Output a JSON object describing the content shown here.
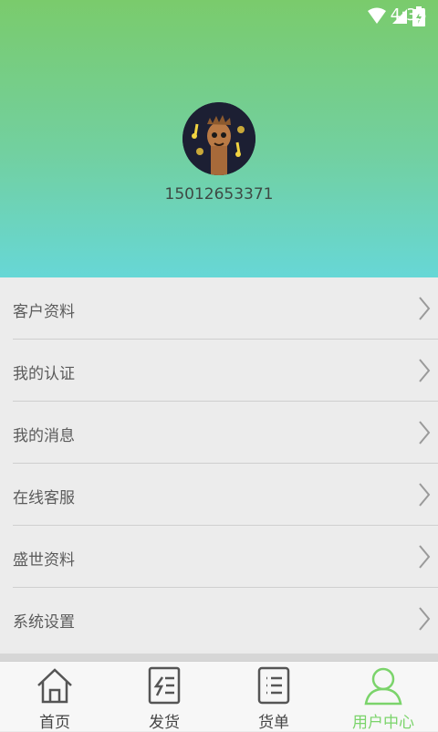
{
  "status_bar": {
    "time": "4:35"
  },
  "profile": {
    "phone": "15012653371"
  },
  "menu": [
    {
      "label": "客户资料"
    },
    {
      "label": "我的认证"
    },
    {
      "label": "我的消息"
    },
    {
      "label": "在线客服"
    },
    {
      "label": "盛世资料"
    },
    {
      "label": "系统设置"
    }
  ],
  "tabs": [
    {
      "label": "首页",
      "icon": "home-icon"
    },
    {
      "label": "发货",
      "icon": "shipping-icon"
    },
    {
      "label": "货单",
      "icon": "list-icon"
    },
    {
      "label": "用户中心",
      "icon": "user-icon",
      "active": true
    }
  ],
  "colors": {
    "accent": "#7bd46b",
    "header_top": "#7acb6c",
    "header_bottom": "#67d7d6"
  }
}
